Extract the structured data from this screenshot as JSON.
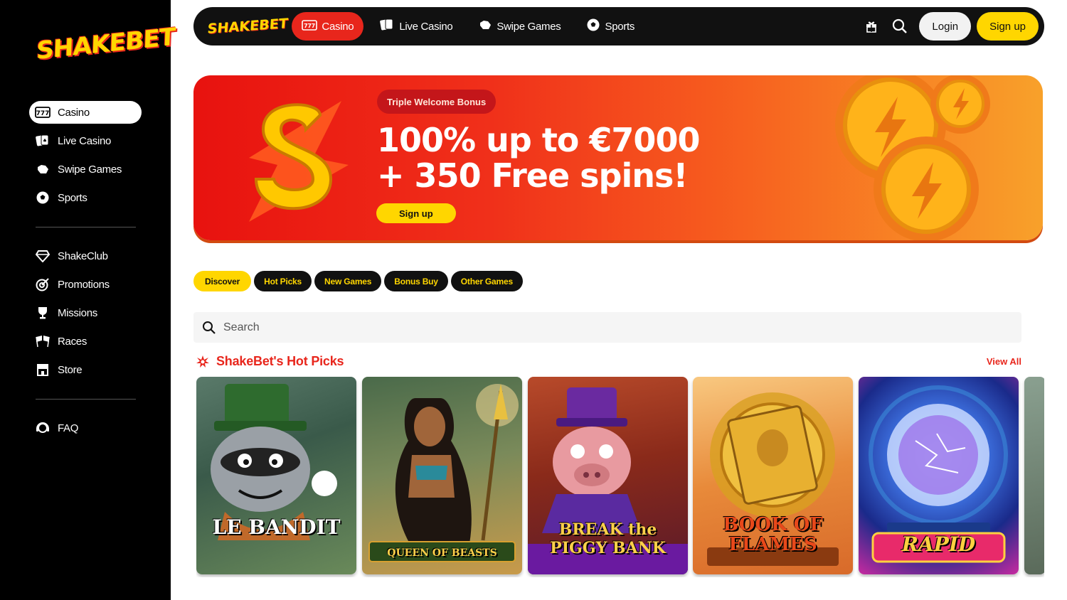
{
  "brand": {
    "name": "SHAKEBET",
    "accent": "#e8261c",
    "yellow": "#ffd600"
  },
  "sidebar": {
    "primary": [
      {
        "label": "Casino",
        "icon": "slot-777-icon",
        "active": true
      },
      {
        "label": "Live Casino",
        "icon": "playing-cards-icon",
        "active": false
      },
      {
        "label": "Swipe Games",
        "icon": "swipe-hand-icon",
        "active": false
      },
      {
        "label": "Sports",
        "icon": "soccer-ball-icon",
        "active": false
      }
    ],
    "secondary": [
      {
        "label": "ShakeClub",
        "icon": "diamond-icon"
      },
      {
        "label": "Promotions",
        "icon": "target-icon"
      },
      {
        "label": "Missions",
        "icon": "trophy-icon"
      },
      {
        "label": "Races",
        "icon": "race-flags-icon"
      },
      {
        "label": "Store",
        "icon": "store-icon"
      }
    ],
    "tertiary": [
      {
        "label": "FAQ",
        "icon": "support-agent-icon"
      }
    ]
  },
  "topbar": {
    "tabs": [
      {
        "label": "Casino",
        "icon": "slot-777-icon",
        "active": true
      },
      {
        "label": "Live Casino",
        "icon": "playing-cards-icon",
        "active": false
      },
      {
        "label": "Swipe Games",
        "icon": "swipe-hand-icon",
        "active": false
      },
      {
        "label": "Sports",
        "icon": "soccer-ball-icon",
        "active": false
      }
    ],
    "login_label": "Login",
    "signup_label": "Sign up"
  },
  "banner": {
    "badge": "Triple Welcome Bonus",
    "title_line1": "100% up to €7000",
    "title_line2": "+ 350 Free spins!",
    "cta": "Sign up"
  },
  "filters": [
    "Discover",
    "Hot Picks",
    "New Games",
    "Bonus Buy",
    "Other Games"
  ],
  "search": {
    "placeholder": "Search"
  },
  "hot_picks": {
    "title": "ShakeBet's Hot Picks",
    "view_all": "View All",
    "games": [
      {
        "title": "LE BANDIT"
      },
      {
        "title": "QUEEN OF BEASTS"
      },
      {
        "title": "BREAK the PIGGY BANK"
      },
      {
        "title": "BOOK OF FLAMES"
      },
      {
        "title": "RAPID"
      }
    ]
  }
}
